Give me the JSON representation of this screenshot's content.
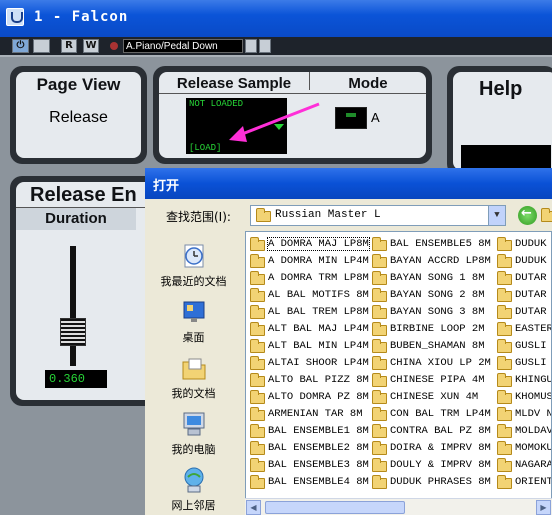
{
  "window": {
    "title": "1 - Falcon"
  },
  "toolbar": {
    "power_label": "⏻",
    "r_label": "R",
    "w_label": "W",
    "preset_name": "A.Piano/Pedal Down"
  },
  "page_view": {
    "title": "Page View",
    "value": "Release"
  },
  "release_sample": {
    "title": "Release Sample",
    "status": "NOT LOADED",
    "load_label": "[LOAD]"
  },
  "mode": {
    "title": "Mode",
    "value": "A"
  },
  "help": {
    "title": "Help"
  },
  "release_env": {
    "title": "Release En",
    "duration_label": "Duration",
    "duration_value": "0.360"
  },
  "dialog": {
    "title": "打开",
    "look_in_label": "查找范围(I):",
    "look_in_value": "Russian Master L",
    "places": [
      "我最近的文档",
      "桌面",
      "我的文档",
      "我的电脑",
      "网上邻居"
    ],
    "columns": [
      [
        "A DOMRA MAJ LP8M",
        "A DOMRA MIN LP4M",
        "A DOMRA TRM LP8M",
        "AL BAL MOTIFS 8M",
        "AL BAL TREM LP8M",
        "ALT BAL MAJ LP4M",
        "ALT BAL MIN LP4M",
        "ALTAI SHOOR LP4M",
        "ALTO BAL PIZZ 8M",
        "ALTO DOMRA PZ 8M",
        "ARMENIAN TAR 8M",
        "BAL ENSEMBLE1 8M",
        "BAL ENSEMBLE2 8M",
        "BAL ENSEMBLE3 8M",
        "BAL ENSEMBLE4 8M"
      ],
      [
        "BAL ENSEMBLE5 8M",
        "BAYAN ACCRD LP8M",
        "BAYAN SONG 1 8M",
        "BAYAN SONG 2 8M",
        "BAYAN SONG 3 8M",
        "BIRBINE LOOP 2M",
        "BUBEN_SHAMAN 8M",
        "CHINA XIOU LP 2M",
        "CHINESE PIPA 4M",
        "CHINESE XUN 4M",
        "CON BAL TRM LP4M",
        "CONTRA BAL PZ 8M",
        "DOIRA & IMPRV 8M",
        "DOULY & IMPRV 8M",
        "DUDUK PHRASES 8M"
      ],
      [
        "DUDUK S",
        "DUDUK V",
        "DUTAR I",
        "DUTAR I",
        "DUTAR I",
        "EASTER",
        "GUSLI M",
        "GUSLI M",
        "KHINGU",
        "KHOMUS",
        "MLDV NA",
        "MOLDAV",
        "MOMOKU",
        "NAGARA",
        "ORIENT"
      ]
    ]
  }
}
